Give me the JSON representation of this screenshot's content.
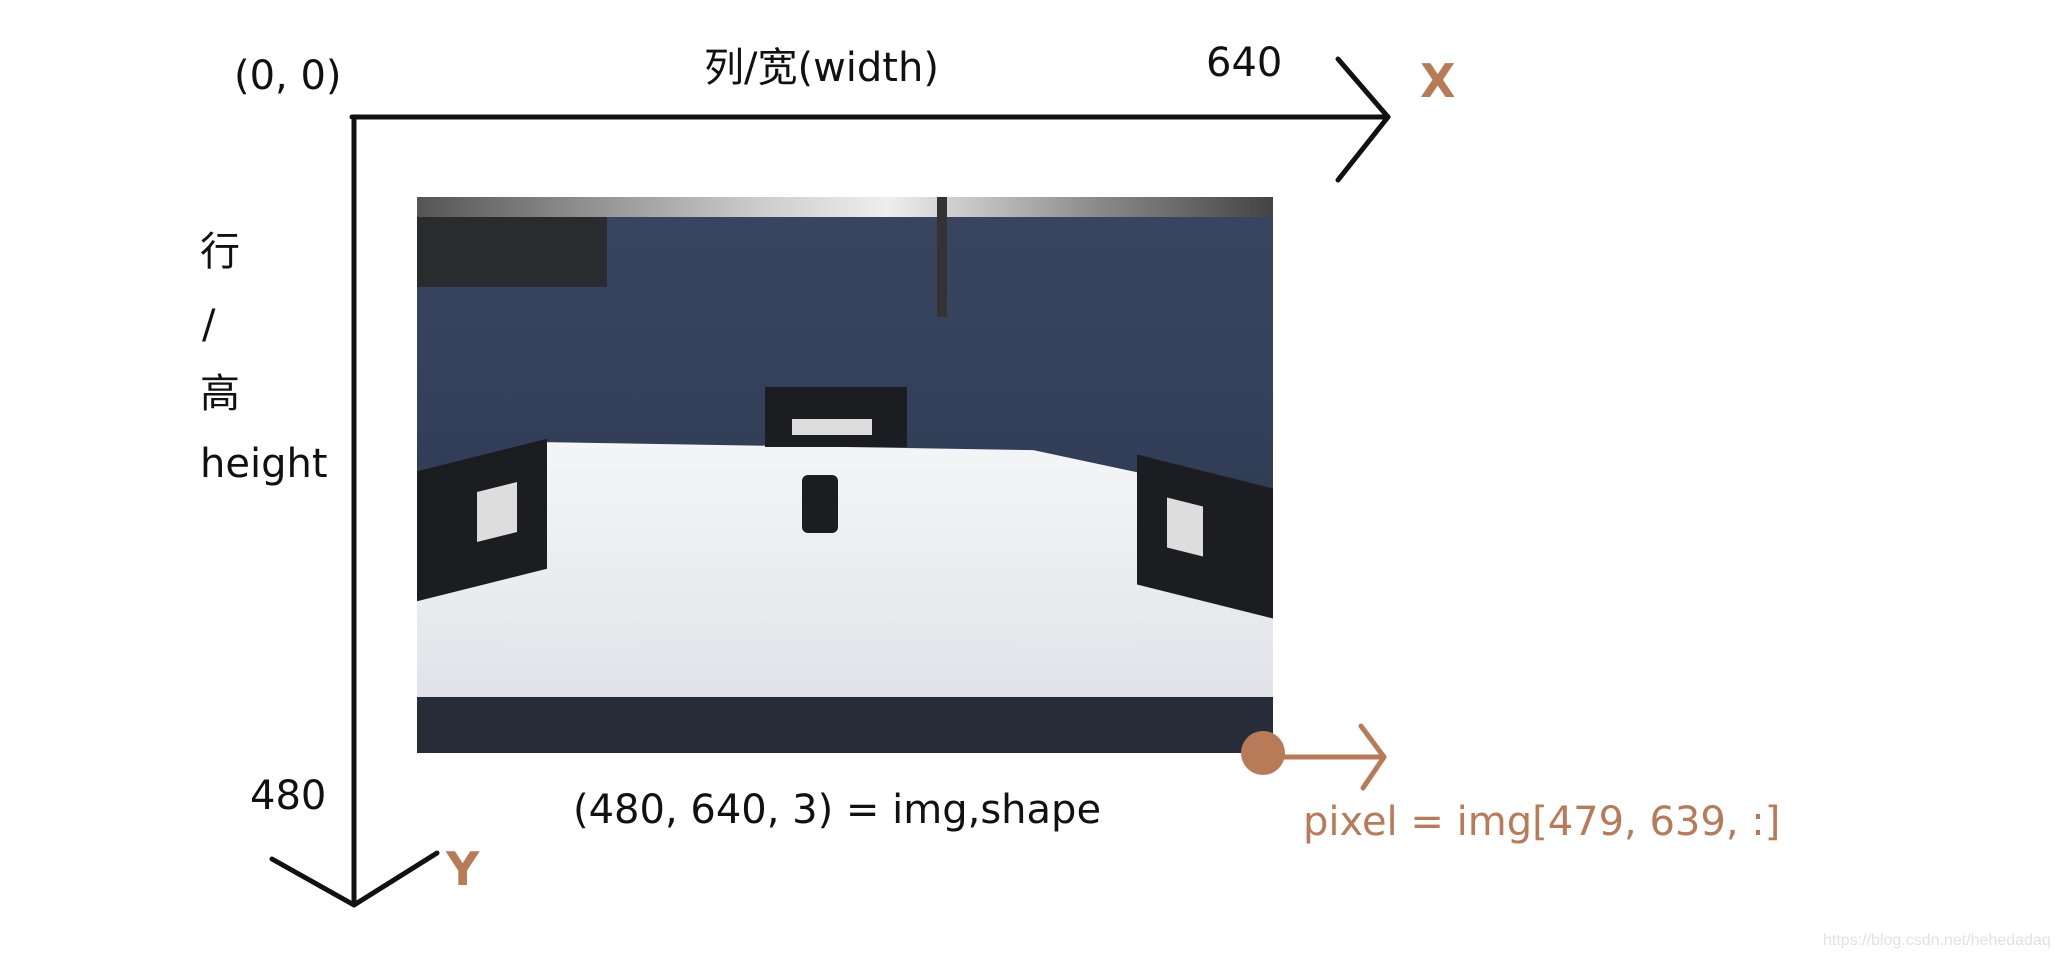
{
  "origin_label": "(0, 0)",
  "x_axis": {
    "title": "列/宽(width)",
    "max_label": "640",
    "axis_name": "X"
  },
  "y_axis": {
    "title_lines": [
      "行",
      "/",
      "高",
      "height"
    ],
    "max_label": "480",
    "axis_name": "Y"
  },
  "shape_caption": "(480, 640, 3) = img,shape",
  "pixel_caption": "pixel = img[479, 639, :]",
  "watermark": "https://blog.csdn.net/hehedadaq",
  "colors": {
    "axis": "#111111",
    "accent": "#b97b57"
  }
}
